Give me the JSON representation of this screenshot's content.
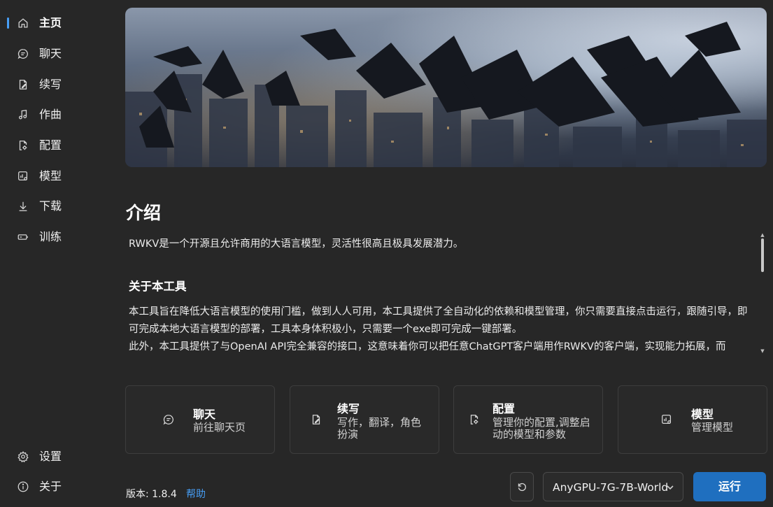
{
  "sidebar": {
    "items": [
      {
        "label": "主页",
        "icon": "home-icon",
        "active": true
      },
      {
        "label": "聊天",
        "icon": "chat-icon"
      },
      {
        "label": "续写",
        "icon": "document-edit-icon"
      },
      {
        "label": "作曲",
        "icon": "music-note-icon"
      },
      {
        "label": "配置",
        "icon": "document-settings-icon"
      },
      {
        "label": "模型",
        "icon": "data-settings-icon"
      },
      {
        "label": "下载",
        "icon": "download-arrow-icon"
      },
      {
        "label": "训练",
        "icon": "battery-icon"
      }
    ],
    "bottom": [
      {
        "label": "设置",
        "icon": "gear-icon"
      },
      {
        "label": "关于",
        "icon": "info-icon"
      }
    ]
  },
  "intro": {
    "title": "介绍",
    "p1": "RWKV是一个开源且允许商用的大语言模型，灵活性很高且极具发展潜力。",
    "h2": "关于本工具",
    "p2a": "本工具旨在降低大语言模型的使用门槛，做到人人可用，本工具提供了全自动化的依赖和模型管理，你只需要直接点击运行，跟随引导，即可完成本地大语言模型的部署，工具本身体积极小，只需要一个exe即可完成一键部署。",
    "p2b": "此外，本工具提供了与OpenAI API完全兼容的接口，这意味着你可以把任意ChatGPT客户端用作RWKV的客户端，实现能力拓展，而"
  },
  "cards": [
    {
      "title": "聊天",
      "desc": "前往聊天页",
      "icon": "chat-icon"
    },
    {
      "title": "续写",
      "desc": "写作，翻译，角色扮演",
      "icon": "document-edit-icon"
    },
    {
      "title": "配置",
      "desc": "管理你的配置,调整启动的模型和参数",
      "icon": "document-settings-icon"
    },
    {
      "title": "模型",
      "desc": "管理模型",
      "icon": "data-settings-icon"
    }
  ],
  "footer": {
    "version": "版本: 1.8.4",
    "help": "帮助",
    "model_value": "AnyGPU-7G-7B-World",
    "run_label": "运行"
  },
  "colors": {
    "background": "#272727",
    "accent": "#479ef5",
    "run_button": "#1f6fbf"
  }
}
